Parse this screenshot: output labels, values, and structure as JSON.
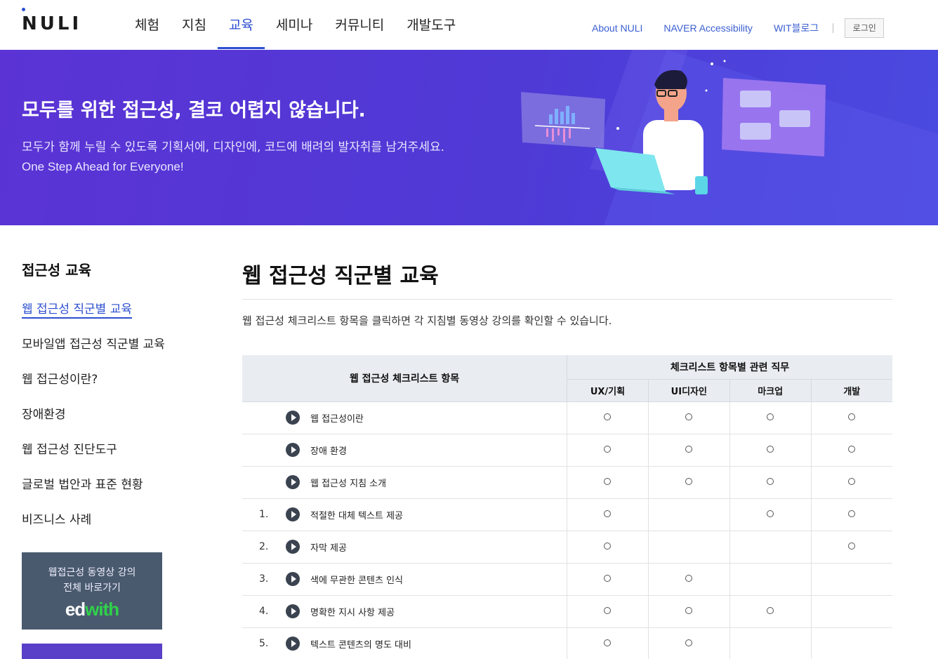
{
  "header": {
    "logo": "NULI",
    "nav": [
      "체험",
      "지침",
      "교육",
      "세미나",
      "커뮤니티",
      "개발도구"
    ],
    "nav_active_index": 2,
    "util_links": [
      "About NULI",
      "NAVER Accessibility",
      "WIT블로그"
    ],
    "login": "로그인"
  },
  "hero": {
    "title": "모두를 위한 접근성, 결코 어렵지 않습니다.",
    "desc": "모두가 함께 누릴 수 있도록 기획서에, 디자인에, 코드에 배려의 발자취를 남겨주세요.",
    "desc_en": "One Step Ahead for Everyone!"
  },
  "lnb": {
    "title": "접근성 교육",
    "items": [
      "웹 접근성 직군별 교육",
      "모바일앱 접근성 직군별 교육",
      "웹 접근성이란?",
      "장애환경",
      "웹 접근성 진단도구",
      "글로벌 법안과 표준 현황",
      "비즈니스 사례"
    ],
    "active_index": 0,
    "banner_line1": "웹접근성 동영상 강의",
    "banner_line2": "전체 바로가기",
    "banner_brand_a": "ed",
    "banner_brand_b": "with"
  },
  "content": {
    "title": "웹 접근성 직군별 교육",
    "desc": "웹 접근성 체크리스트 항목을 클릭하면 각 지침별 동영상 강의를 확인할 수 있습니다.",
    "table": {
      "head_item": "웹 접근성 체크리스트 항목",
      "head_group": "체크리스트 항목별 관련 직무",
      "jobs": [
        "UX/기획",
        "UI디자인",
        "마크업",
        "개발"
      ],
      "mark": "○",
      "rows": [
        {
          "num": "",
          "label": "웹 접근성이란",
          "marks": [
            true,
            true,
            true,
            true
          ]
        },
        {
          "num": "",
          "label": "장애 환경",
          "marks": [
            true,
            true,
            true,
            true
          ]
        },
        {
          "num": "",
          "label": "웹 접근성 지침 소개",
          "marks": [
            true,
            true,
            true,
            true
          ]
        },
        {
          "num": "1.",
          "label": "적절한 대체 텍스트 제공",
          "marks": [
            true,
            false,
            true,
            true
          ]
        },
        {
          "num": "2.",
          "label": "자막 제공",
          "marks": [
            true,
            false,
            false,
            true
          ]
        },
        {
          "num": "3.",
          "label": "색에 무관한 콘텐츠 인식",
          "marks": [
            true,
            true,
            false,
            false
          ]
        },
        {
          "num": "4.",
          "label": "명확한 지시 사항 제공",
          "marks": [
            true,
            true,
            true,
            false
          ]
        },
        {
          "num": "5.",
          "label": "텍스트 콘텐츠의 명도 대비",
          "marks": [
            true,
            true,
            false,
            false
          ]
        }
      ]
    }
  }
}
